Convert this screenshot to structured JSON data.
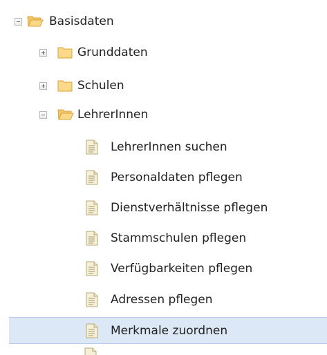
{
  "tree": {
    "root": {
      "label": "Basisdaten",
      "toggle": "collapse",
      "icon": "folder-open-icon"
    },
    "groups": [
      {
        "label": "Grunddaten",
        "toggle": "expand",
        "icon": "folder-closed-icon"
      },
      {
        "label": "Schulen",
        "toggle": "expand",
        "icon": "folder-closed-icon"
      },
      {
        "label": "LehrerInnen",
        "toggle": "collapse",
        "icon": "folder-open-icon"
      }
    ],
    "pages": [
      {
        "label": "LehrerInnen suchen",
        "icon": "document-icon"
      },
      {
        "label": "Personaldaten pflegen",
        "icon": "document-icon"
      },
      {
        "label": "Dienstverhältnisse pflegen",
        "icon": "document-icon"
      },
      {
        "label": "Stammschulen pflegen",
        "icon": "document-icon"
      },
      {
        "label": "Verfügbarkeiten pflegen",
        "icon": "document-icon"
      },
      {
        "label": "Adressen pflegen",
        "icon": "document-icon"
      },
      {
        "label": "Merkmale zuordnen",
        "icon": "document-icon",
        "selected": true
      }
    ]
  },
  "colors": {
    "selection_bg": "#dde8f6",
    "selection_border": "#b8cde8",
    "folder_fill": "#fbd989",
    "folder_stroke": "#d9a53a",
    "document_fill": "#f6f0d8",
    "document_stroke": "#b8a877"
  }
}
